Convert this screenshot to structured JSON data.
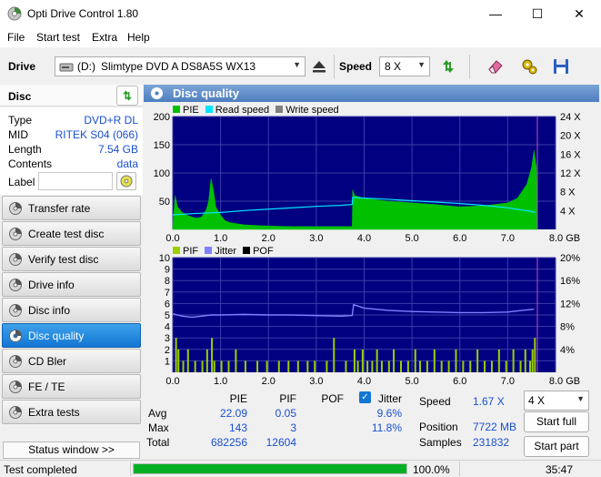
{
  "window": {
    "title": "Opti Drive Control 1.80",
    "minimize": "—",
    "maximize": "☐",
    "close": "✕"
  },
  "menu": [
    "File",
    "Start test",
    "Extra",
    "Help"
  ],
  "toolbar": {
    "drive_label": "Drive",
    "drive_letter": "(D:)",
    "drive_value": "Slimtype DVD A  DS8A5S WX13",
    "speed_label": "Speed",
    "speed_value": "8 X"
  },
  "disc": {
    "header": "Disc",
    "rows": [
      {
        "label": "Type",
        "value": "DVD+R DL"
      },
      {
        "label": "MID",
        "value": "RITEK S04 (066)"
      },
      {
        "label": "Length",
        "value": "7.54 GB"
      },
      {
        "label": "Contents",
        "value": "data"
      }
    ],
    "label_field": "Label"
  },
  "nav": [
    {
      "label": "Transfer rate",
      "active": false
    },
    {
      "label": "Create test disc",
      "active": false
    },
    {
      "label": "Verify test disc",
      "active": false
    },
    {
      "label": "Drive info",
      "active": false
    },
    {
      "label": "Disc info",
      "active": false
    },
    {
      "label": "Disc quality",
      "active": true
    },
    {
      "label": "CD Bler",
      "active": false
    },
    {
      "label": "FE / TE",
      "active": false
    },
    {
      "label": "Extra tests",
      "active": false
    }
  ],
  "status_window_btn": "Status window >>",
  "panel_title": "Disc quality",
  "colors": {
    "pie": "#00c000",
    "read": "#00e5ff",
    "write": "#808080",
    "pif": "#9ad000",
    "jitter": "#8080ff",
    "pof": "#000000",
    "plot_bg": "#000080",
    "accent": "#1276d3"
  },
  "chart_data": [
    {
      "type": "area",
      "legend": [
        "PIE",
        "Read speed",
        "Write speed"
      ],
      "x_ticks": [
        "0.0",
        "1.0",
        "2.0",
        "3.0",
        "4.0",
        "5.0",
        "6.0",
        "7.0",
        "8.0 GB"
      ],
      "y_left_ticks": [
        "200",
        "150",
        "100",
        "50"
      ],
      "y_right_ticks": [
        "24 X",
        "20 X",
        "16 X",
        "12 X",
        "8 X",
        "4 X"
      ],
      "xlim": [
        0,
        8
      ],
      "ylim": [
        0,
        200
      ],
      "y2lim": [
        0,
        24
      ],
      "series": [
        {
          "name": "PIE",
          "points": [
            [
              0,
              5
            ],
            [
              0.05,
              60
            ],
            [
              0.1,
              40
            ],
            [
              0.2,
              30
            ],
            [
              0.3,
              25
            ],
            [
              0.4,
              22
            ],
            [
              0.5,
              20
            ],
            [
              0.6,
              22
            ],
            [
              0.7,
              35
            ],
            [
              0.75,
              50
            ],
            [
              0.8,
              90
            ],
            [
              0.85,
              70
            ],
            [
              0.9,
              40
            ],
            [
              1.0,
              25
            ],
            [
              1.1,
              15
            ],
            [
              1.2,
              12
            ],
            [
              1.5,
              8
            ],
            [
              2.0,
              6
            ],
            [
              2.5,
              5
            ],
            [
              3.0,
              5
            ],
            [
              3.5,
              5
            ],
            [
              3.75,
              5
            ],
            [
              3.76,
              70
            ],
            [
              3.8,
              60
            ],
            [
              4.0,
              55
            ],
            [
              4.5,
              50
            ],
            [
              5.0,
              47
            ],
            [
              5.5,
              44
            ],
            [
              6.0,
              40
            ],
            [
              6.5,
              42
            ],
            [
              7.0,
              47
            ],
            [
              7.2,
              55
            ],
            [
              7.4,
              80
            ],
            [
              7.5,
              110
            ],
            [
              7.55,
              140
            ],
            [
              7.6,
              110
            ],
            [
              7.62,
              0
            ]
          ]
        },
        {
          "name": "Read speed",
          "points": [
            [
              0,
              3.1
            ],
            [
              0.5,
              3.4
            ],
            [
              1.0,
              3.6
            ],
            [
              1.5,
              4.0
            ],
            [
              2.0,
              4.3
            ],
            [
              2.5,
              4.6
            ],
            [
              3.0,
              4.9
            ],
            [
              3.5,
              5.1
            ],
            [
              3.75,
              5.3
            ],
            [
              3.76,
              6.8
            ],
            [
              4.5,
              6.4
            ],
            [
              5.0,
              6.1
            ],
            [
              5.5,
              5.8
            ],
            [
              6.0,
              5.5
            ],
            [
              6.5,
              5.1
            ],
            [
              7.0,
              4.6
            ],
            [
              7.5,
              3.8
            ],
            [
              7.58,
              3.6
            ]
          ]
        }
      ]
    },
    {
      "type": "bar",
      "legend": [
        "PIF",
        "Jitter",
        "POF"
      ],
      "x_ticks": [
        "0.0",
        "1.0",
        "2.0",
        "3.0",
        "4.0",
        "5.0",
        "6.0",
        "7.0",
        "8.0 GB"
      ],
      "y_left_ticks": [
        "10",
        "9",
        "8",
        "7",
        "6",
        "5",
        "4",
        "3",
        "2",
        "1"
      ],
      "y_right_ticks": [
        "20%",
        "16%",
        "12%",
        "8%",
        "4%"
      ],
      "xlim": [
        0,
        8
      ],
      "ylim": [
        0,
        10
      ],
      "y2lim": [
        0,
        20
      ],
      "series": [
        {
          "name": "PIF",
          "bars": [
            [
              0.05,
              3
            ],
            [
              0.1,
              2
            ],
            [
              0.2,
              1
            ],
            [
              0.3,
              2
            ],
            [
              0.45,
              1
            ],
            [
              0.6,
              1
            ],
            [
              0.7,
              2
            ],
            [
              0.8,
              3
            ],
            [
              0.85,
              1
            ],
            [
              1.0,
              1
            ],
            [
              1.15,
              1
            ],
            [
              1.3,
              2
            ],
            [
              1.5,
              1
            ],
            [
              1.75,
              1
            ],
            [
              1.95,
              1
            ],
            [
              2.2,
              1
            ],
            [
              2.4,
              1
            ],
            [
              2.6,
              1
            ],
            [
              2.8,
              1
            ],
            [
              2.95,
              1
            ],
            [
              3.2,
              1
            ],
            [
              3.35,
              3
            ],
            [
              3.6,
              1
            ],
            [
              3.78,
              2
            ],
            [
              3.85,
              1
            ],
            [
              3.95,
              2
            ],
            [
              4.05,
              1
            ],
            [
              4.15,
              1
            ],
            [
              4.25,
              2
            ],
            [
              4.35,
              1
            ],
            [
              4.5,
              1
            ],
            [
              4.6,
              2
            ],
            [
              4.75,
              1
            ],
            [
              4.9,
              1
            ],
            [
              5.05,
              2
            ],
            [
              5.15,
              1
            ],
            [
              5.3,
              1
            ],
            [
              5.45,
              2
            ],
            [
              5.6,
              1
            ],
            [
              5.75,
              1
            ],
            [
              5.9,
              2
            ],
            [
              6.05,
              1
            ],
            [
              6.2,
              1
            ],
            [
              6.35,
              2
            ],
            [
              6.5,
              1
            ],
            [
              6.65,
              1
            ],
            [
              6.8,
              2
            ],
            [
              6.95,
              1
            ],
            [
              7.1,
              2
            ],
            [
              7.25,
              1
            ],
            [
              7.35,
              2
            ],
            [
              7.45,
              1
            ],
            [
              7.5,
              2
            ],
            [
              7.55,
              3
            ]
          ]
        },
        {
          "name": "Jitter",
          "points": [
            [
              0,
              10.2
            ],
            [
              0.2,
              9.8
            ],
            [
              0.4,
              9.6
            ],
            [
              0.6,
              9.8
            ],
            [
              0.8,
              10.0
            ],
            [
              1.0,
              10.0
            ],
            [
              1.5,
              10.1
            ],
            [
              2.0,
              10.0
            ],
            [
              2.5,
              10.0
            ],
            [
              3.0,
              9.9
            ],
            [
              3.5,
              9.8
            ],
            [
              3.75,
              9.9
            ],
            [
              3.78,
              11.8
            ],
            [
              4.0,
              11.2
            ],
            [
              4.5,
              10.8
            ],
            [
              5.0,
              10.6
            ],
            [
              5.5,
              10.5
            ],
            [
              6.0,
              10.4
            ],
            [
              6.5,
              10.4
            ],
            [
              7.0,
              10.5
            ],
            [
              7.3,
              10.8
            ],
            [
              7.55,
              11.0
            ]
          ]
        }
      ]
    }
  ],
  "stats": {
    "headers": [
      "PIE",
      "PIF",
      "POF",
      "Jitter"
    ],
    "jitter_checked": true,
    "rows": [
      {
        "label": "Avg",
        "pie": "22.09",
        "pif": "0.05",
        "pof": "",
        "jitter": "9.6%"
      },
      {
        "label": "Max",
        "pie": "143",
        "pif": "3",
        "pof": "",
        "jitter": "11.8%"
      },
      {
        "label": "Total",
        "pie": "682256",
        "pif": "12604",
        "pof": "",
        "jitter": ""
      }
    ],
    "speed_label": "Speed",
    "speed_value": "1.67 X",
    "position_label": "Position",
    "position_value": "7722 MB",
    "samples_label": "Samples",
    "samples_value": "231832",
    "speed_select": "4 X",
    "start_full": "Start full",
    "start_part": "Start part"
  },
  "status": {
    "text": "Test completed",
    "progress": 100.0,
    "progress_text": "100.0%",
    "time": "35:47"
  }
}
